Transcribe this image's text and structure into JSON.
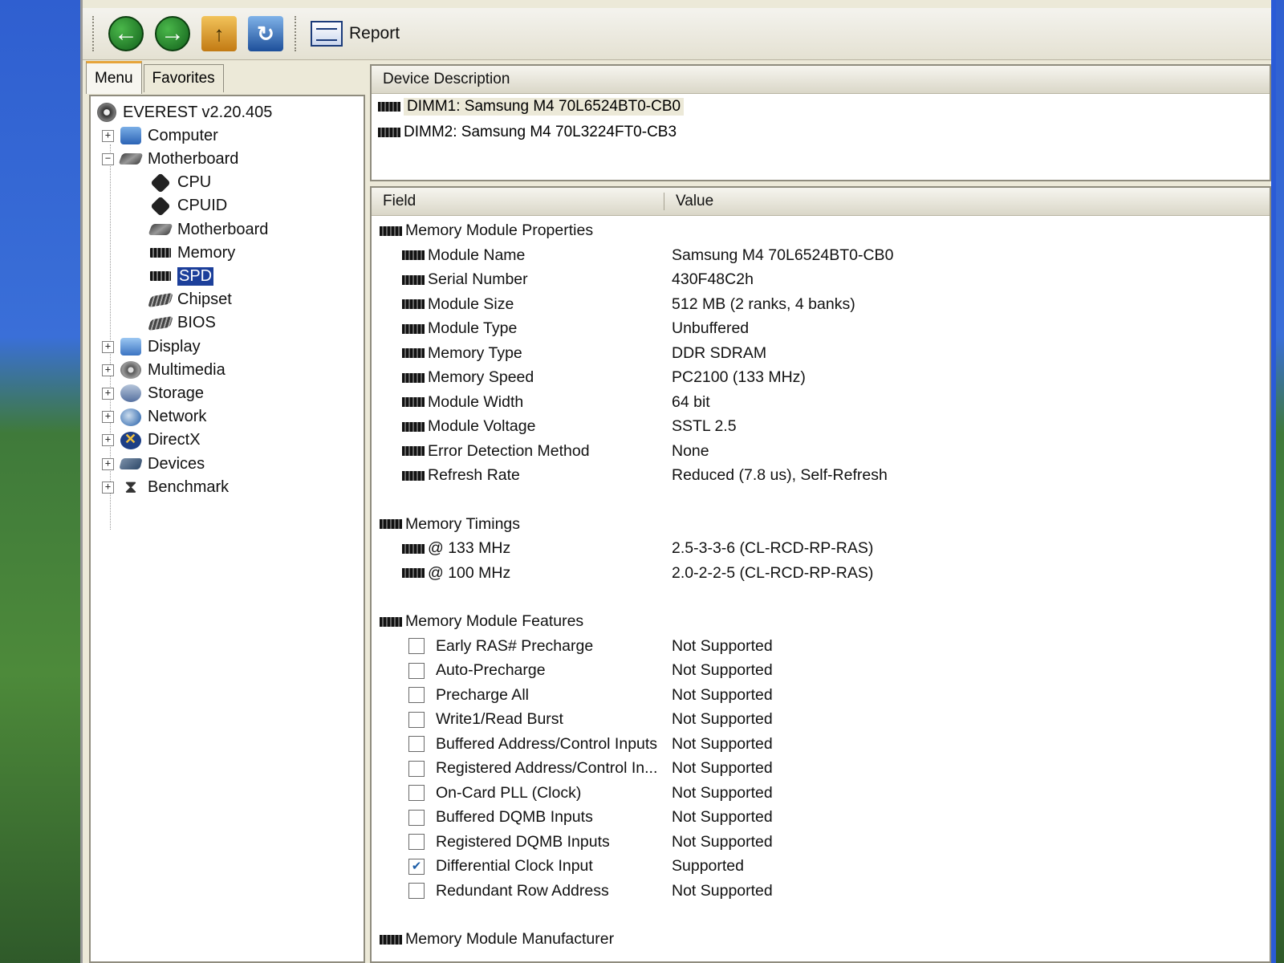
{
  "toolbar": {
    "report_label": "Report"
  },
  "left_tabs": [
    "Menu",
    "Favorites"
  ],
  "tree": [
    {
      "label": "EVEREST v2.20.405",
      "icon": "everest-icon",
      "level": 0,
      "expander": ""
    },
    {
      "label": "Computer",
      "icon": "computer-icon",
      "level": 1,
      "expander": "+"
    },
    {
      "label": "Motherboard",
      "icon": "motherboard-icon",
      "level": 1,
      "expander": "−"
    },
    {
      "label": "CPU",
      "icon": "cpu-icon",
      "level": 2,
      "expander": ""
    },
    {
      "label": "CPUID",
      "icon": "cpu-icon",
      "level": 2,
      "expander": ""
    },
    {
      "label": "Motherboard",
      "icon": "motherboard-icon",
      "level": 2,
      "expander": ""
    },
    {
      "label": "Memory",
      "icon": "memory-icon",
      "level": 2,
      "expander": ""
    },
    {
      "label": "SPD",
      "icon": "memory-icon",
      "level": 2,
      "expander": "",
      "selected": true
    },
    {
      "label": "Chipset",
      "icon": "chip-icon",
      "level": 2,
      "expander": ""
    },
    {
      "label": "BIOS",
      "icon": "chip-icon",
      "level": 2,
      "expander": ""
    },
    {
      "label": "Display",
      "icon": "display-icon",
      "level": 1,
      "expander": "+"
    },
    {
      "label": "Multimedia",
      "icon": "multimedia-icon",
      "level": 1,
      "expander": "+"
    },
    {
      "label": "Storage",
      "icon": "storage-icon",
      "level": 1,
      "expander": "+"
    },
    {
      "label": "Network",
      "icon": "network-icon",
      "level": 1,
      "expander": "+"
    },
    {
      "label": "DirectX",
      "icon": "directx-icon",
      "level": 1,
      "expander": "+"
    },
    {
      "label": "Devices",
      "icon": "devices-icon",
      "level": 1,
      "expander": "+"
    },
    {
      "label": "Benchmark",
      "icon": "hourglass-icon",
      "level": 1,
      "expander": "+"
    }
  ],
  "device_pane": {
    "header": "Device Description",
    "devices": [
      {
        "label": "DIMM1: Samsung M4 70L6524BT0-CB0",
        "selected": true
      },
      {
        "label": "DIMM2: Samsung M4 70L3224FT0-CB3",
        "selected": false
      }
    ]
  },
  "detail_pane": {
    "field_header": "Field",
    "value_header": "Value",
    "rows": [
      {
        "kind": "section",
        "field": "Memory Module Properties",
        "value": ""
      },
      {
        "kind": "item",
        "field": "Module Name",
        "value": "Samsung M4 70L6524BT0-CB0"
      },
      {
        "kind": "item",
        "field": "Serial Number",
        "value": "430F48C2h"
      },
      {
        "kind": "item",
        "field": "Module Size",
        "value": "512 MB (2 ranks, 4 banks)"
      },
      {
        "kind": "item",
        "field": "Module Type",
        "value": "Unbuffered"
      },
      {
        "kind": "item",
        "field": "Memory Type",
        "value": "DDR SDRAM"
      },
      {
        "kind": "item",
        "field": "Memory Speed",
        "value": "PC2100 (133 MHz)"
      },
      {
        "kind": "item",
        "field": "Module Width",
        "value": "64 bit"
      },
      {
        "kind": "item",
        "field": "Module Voltage",
        "value": "SSTL 2.5"
      },
      {
        "kind": "item",
        "field": "Error Detection Method",
        "value": "None"
      },
      {
        "kind": "item",
        "field": "Refresh Rate",
        "value": "Reduced (7.8 us), Self-Refresh"
      },
      {
        "kind": "blank"
      },
      {
        "kind": "section",
        "field": "Memory Timings",
        "value": ""
      },
      {
        "kind": "item",
        "field": "@ 133 MHz",
        "value": "2.5-3-3-6  (CL-RCD-RP-RAS)"
      },
      {
        "kind": "item",
        "field": "@ 100 MHz",
        "value": "2.0-2-2-5  (CL-RCD-RP-RAS)"
      },
      {
        "kind": "blank"
      },
      {
        "kind": "section",
        "field": "Memory Module Features",
        "value": ""
      },
      {
        "kind": "check",
        "checked": false,
        "field": "Early RAS# Precharge",
        "value": "Not Supported"
      },
      {
        "kind": "check",
        "checked": false,
        "field": "Auto-Precharge",
        "value": "Not Supported"
      },
      {
        "kind": "check",
        "checked": false,
        "field": "Precharge All",
        "value": "Not Supported"
      },
      {
        "kind": "check",
        "checked": false,
        "field": "Write1/Read Burst",
        "value": "Not Supported"
      },
      {
        "kind": "check",
        "checked": false,
        "field": "Buffered Address/Control Inputs",
        "value": "Not Supported"
      },
      {
        "kind": "check",
        "checked": false,
        "field": "Registered Address/Control In...",
        "value": "Not Supported"
      },
      {
        "kind": "check",
        "checked": false,
        "field": "On-Card PLL (Clock)",
        "value": "Not Supported"
      },
      {
        "kind": "check",
        "checked": false,
        "field": "Buffered DQMB Inputs",
        "value": "Not Supported"
      },
      {
        "kind": "check",
        "checked": false,
        "field": "Registered DQMB Inputs",
        "value": "Not Supported"
      },
      {
        "kind": "check",
        "checked": true,
        "field": "Differential Clock Input",
        "value": "Supported"
      },
      {
        "kind": "check",
        "checked": false,
        "field": "Redundant Row Address",
        "value": "Not Supported"
      },
      {
        "kind": "blank"
      },
      {
        "kind": "section",
        "field": "Memory Module Manufacturer",
        "value": ""
      }
    ]
  }
}
